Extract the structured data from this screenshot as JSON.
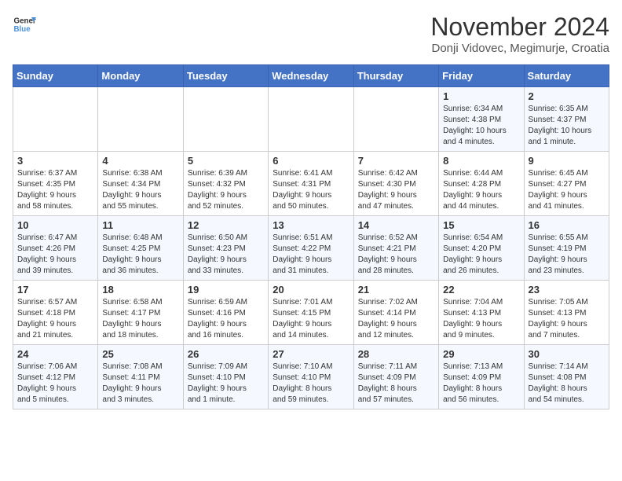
{
  "header": {
    "logo_line1": "General",
    "logo_line2": "Blue",
    "month_title": "November 2024",
    "location": "Donji Vidovec, Megimurje, Croatia"
  },
  "weekdays": [
    "Sunday",
    "Monday",
    "Tuesday",
    "Wednesday",
    "Thursday",
    "Friday",
    "Saturday"
  ],
  "weeks": [
    [
      {
        "day": "",
        "info": ""
      },
      {
        "day": "",
        "info": ""
      },
      {
        "day": "",
        "info": ""
      },
      {
        "day": "",
        "info": ""
      },
      {
        "day": "",
        "info": ""
      },
      {
        "day": "1",
        "info": "Sunrise: 6:34 AM\nSunset: 4:38 PM\nDaylight: 10 hours\nand 4 minutes."
      },
      {
        "day": "2",
        "info": "Sunrise: 6:35 AM\nSunset: 4:37 PM\nDaylight: 10 hours\nand 1 minute."
      }
    ],
    [
      {
        "day": "3",
        "info": "Sunrise: 6:37 AM\nSunset: 4:35 PM\nDaylight: 9 hours\nand 58 minutes."
      },
      {
        "day": "4",
        "info": "Sunrise: 6:38 AM\nSunset: 4:34 PM\nDaylight: 9 hours\nand 55 minutes."
      },
      {
        "day": "5",
        "info": "Sunrise: 6:39 AM\nSunset: 4:32 PM\nDaylight: 9 hours\nand 52 minutes."
      },
      {
        "day": "6",
        "info": "Sunrise: 6:41 AM\nSunset: 4:31 PM\nDaylight: 9 hours\nand 50 minutes."
      },
      {
        "day": "7",
        "info": "Sunrise: 6:42 AM\nSunset: 4:30 PM\nDaylight: 9 hours\nand 47 minutes."
      },
      {
        "day": "8",
        "info": "Sunrise: 6:44 AM\nSunset: 4:28 PM\nDaylight: 9 hours\nand 44 minutes."
      },
      {
        "day": "9",
        "info": "Sunrise: 6:45 AM\nSunset: 4:27 PM\nDaylight: 9 hours\nand 41 minutes."
      }
    ],
    [
      {
        "day": "10",
        "info": "Sunrise: 6:47 AM\nSunset: 4:26 PM\nDaylight: 9 hours\nand 39 minutes."
      },
      {
        "day": "11",
        "info": "Sunrise: 6:48 AM\nSunset: 4:25 PM\nDaylight: 9 hours\nand 36 minutes."
      },
      {
        "day": "12",
        "info": "Sunrise: 6:50 AM\nSunset: 4:23 PM\nDaylight: 9 hours\nand 33 minutes."
      },
      {
        "day": "13",
        "info": "Sunrise: 6:51 AM\nSunset: 4:22 PM\nDaylight: 9 hours\nand 31 minutes."
      },
      {
        "day": "14",
        "info": "Sunrise: 6:52 AM\nSunset: 4:21 PM\nDaylight: 9 hours\nand 28 minutes."
      },
      {
        "day": "15",
        "info": "Sunrise: 6:54 AM\nSunset: 4:20 PM\nDaylight: 9 hours\nand 26 minutes."
      },
      {
        "day": "16",
        "info": "Sunrise: 6:55 AM\nSunset: 4:19 PM\nDaylight: 9 hours\nand 23 minutes."
      }
    ],
    [
      {
        "day": "17",
        "info": "Sunrise: 6:57 AM\nSunset: 4:18 PM\nDaylight: 9 hours\nand 21 minutes."
      },
      {
        "day": "18",
        "info": "Sunrise: 6:58 AM\nSunset: 4:17 PM\nDaylight: 9 hours\nand 18 minutes."
      },
      {
        "day": "19",
        "info": "Sunrise: 6:59 AM\nSunset: 4:16 PM\nDaylight: 9 hours\nand 16 minutes."
      },
      {
        "day": "20",
        "info": "Sunrise: 7:01 AM\nSunset: 4:15 PM\nDaylight: 9 hours\nand 14 minutes."
      },
      {
        "day": "21",
        "info": "Sunrise: 7:02 AM\nSunset: 4:14 PM\nDaylight: 9 hours\nand 12 minutes."
      },
      {
        "day": "22",
        "info": "Sunrise: 7:04 AM\nSunset: 4:13 PM\nDaylight: 9 hours\nand 9 minutes."
      },
      {
        "day": "23",
        "info": "Sunrise: 7:05 AM\nSunset: 4:13 PM\nDaylight: 9 hours\nand 7 minutes."
      }
    ],
    [
      {
        "day": "24",
        "info": "Sunrise: 7:06 AM\nSunset: 4:12 PM\nDaylight: 9 hours\nand 5 minutes."
      },
      {
        "day": "25",
        "info": "Sunrise: 7:08 AM\nSunset: 4:11 PM\nDaylight: 9 hours\nand 3 minutes."
      },
      {
        "day": "26",
        "info": "Sunrise: 7:09 AM\nSunset: 4:10 PM\nDaylight: 9 hours\nand 1 minute."
      },
      {
        "day": "27",
        "info": "Sunrise: 7:10 AM\nSunset: 4:10 PM\nDaylight: 8 hours\nand 59 minutes."
      },
      {
        "day": "28",
        "info": "Sunrise: 7:11 AM\nSunset: 4:09 PM\nDaylight: 8 hours\nand 57 minutes."
      },
      {
        "day": "29",
        "info": "Sunrise: 7:13 AM\nSunset: 4:09 PM\nDaylight: 8 hours\nand 56 minutes."
      },
      {
        "day": "30",
        "info": "Sunrise: 7:14 AM\nSunset: 4:08 PM\nDaylight: 8 hours\nand 54 minutes."
      }
    ]
  ]
}
